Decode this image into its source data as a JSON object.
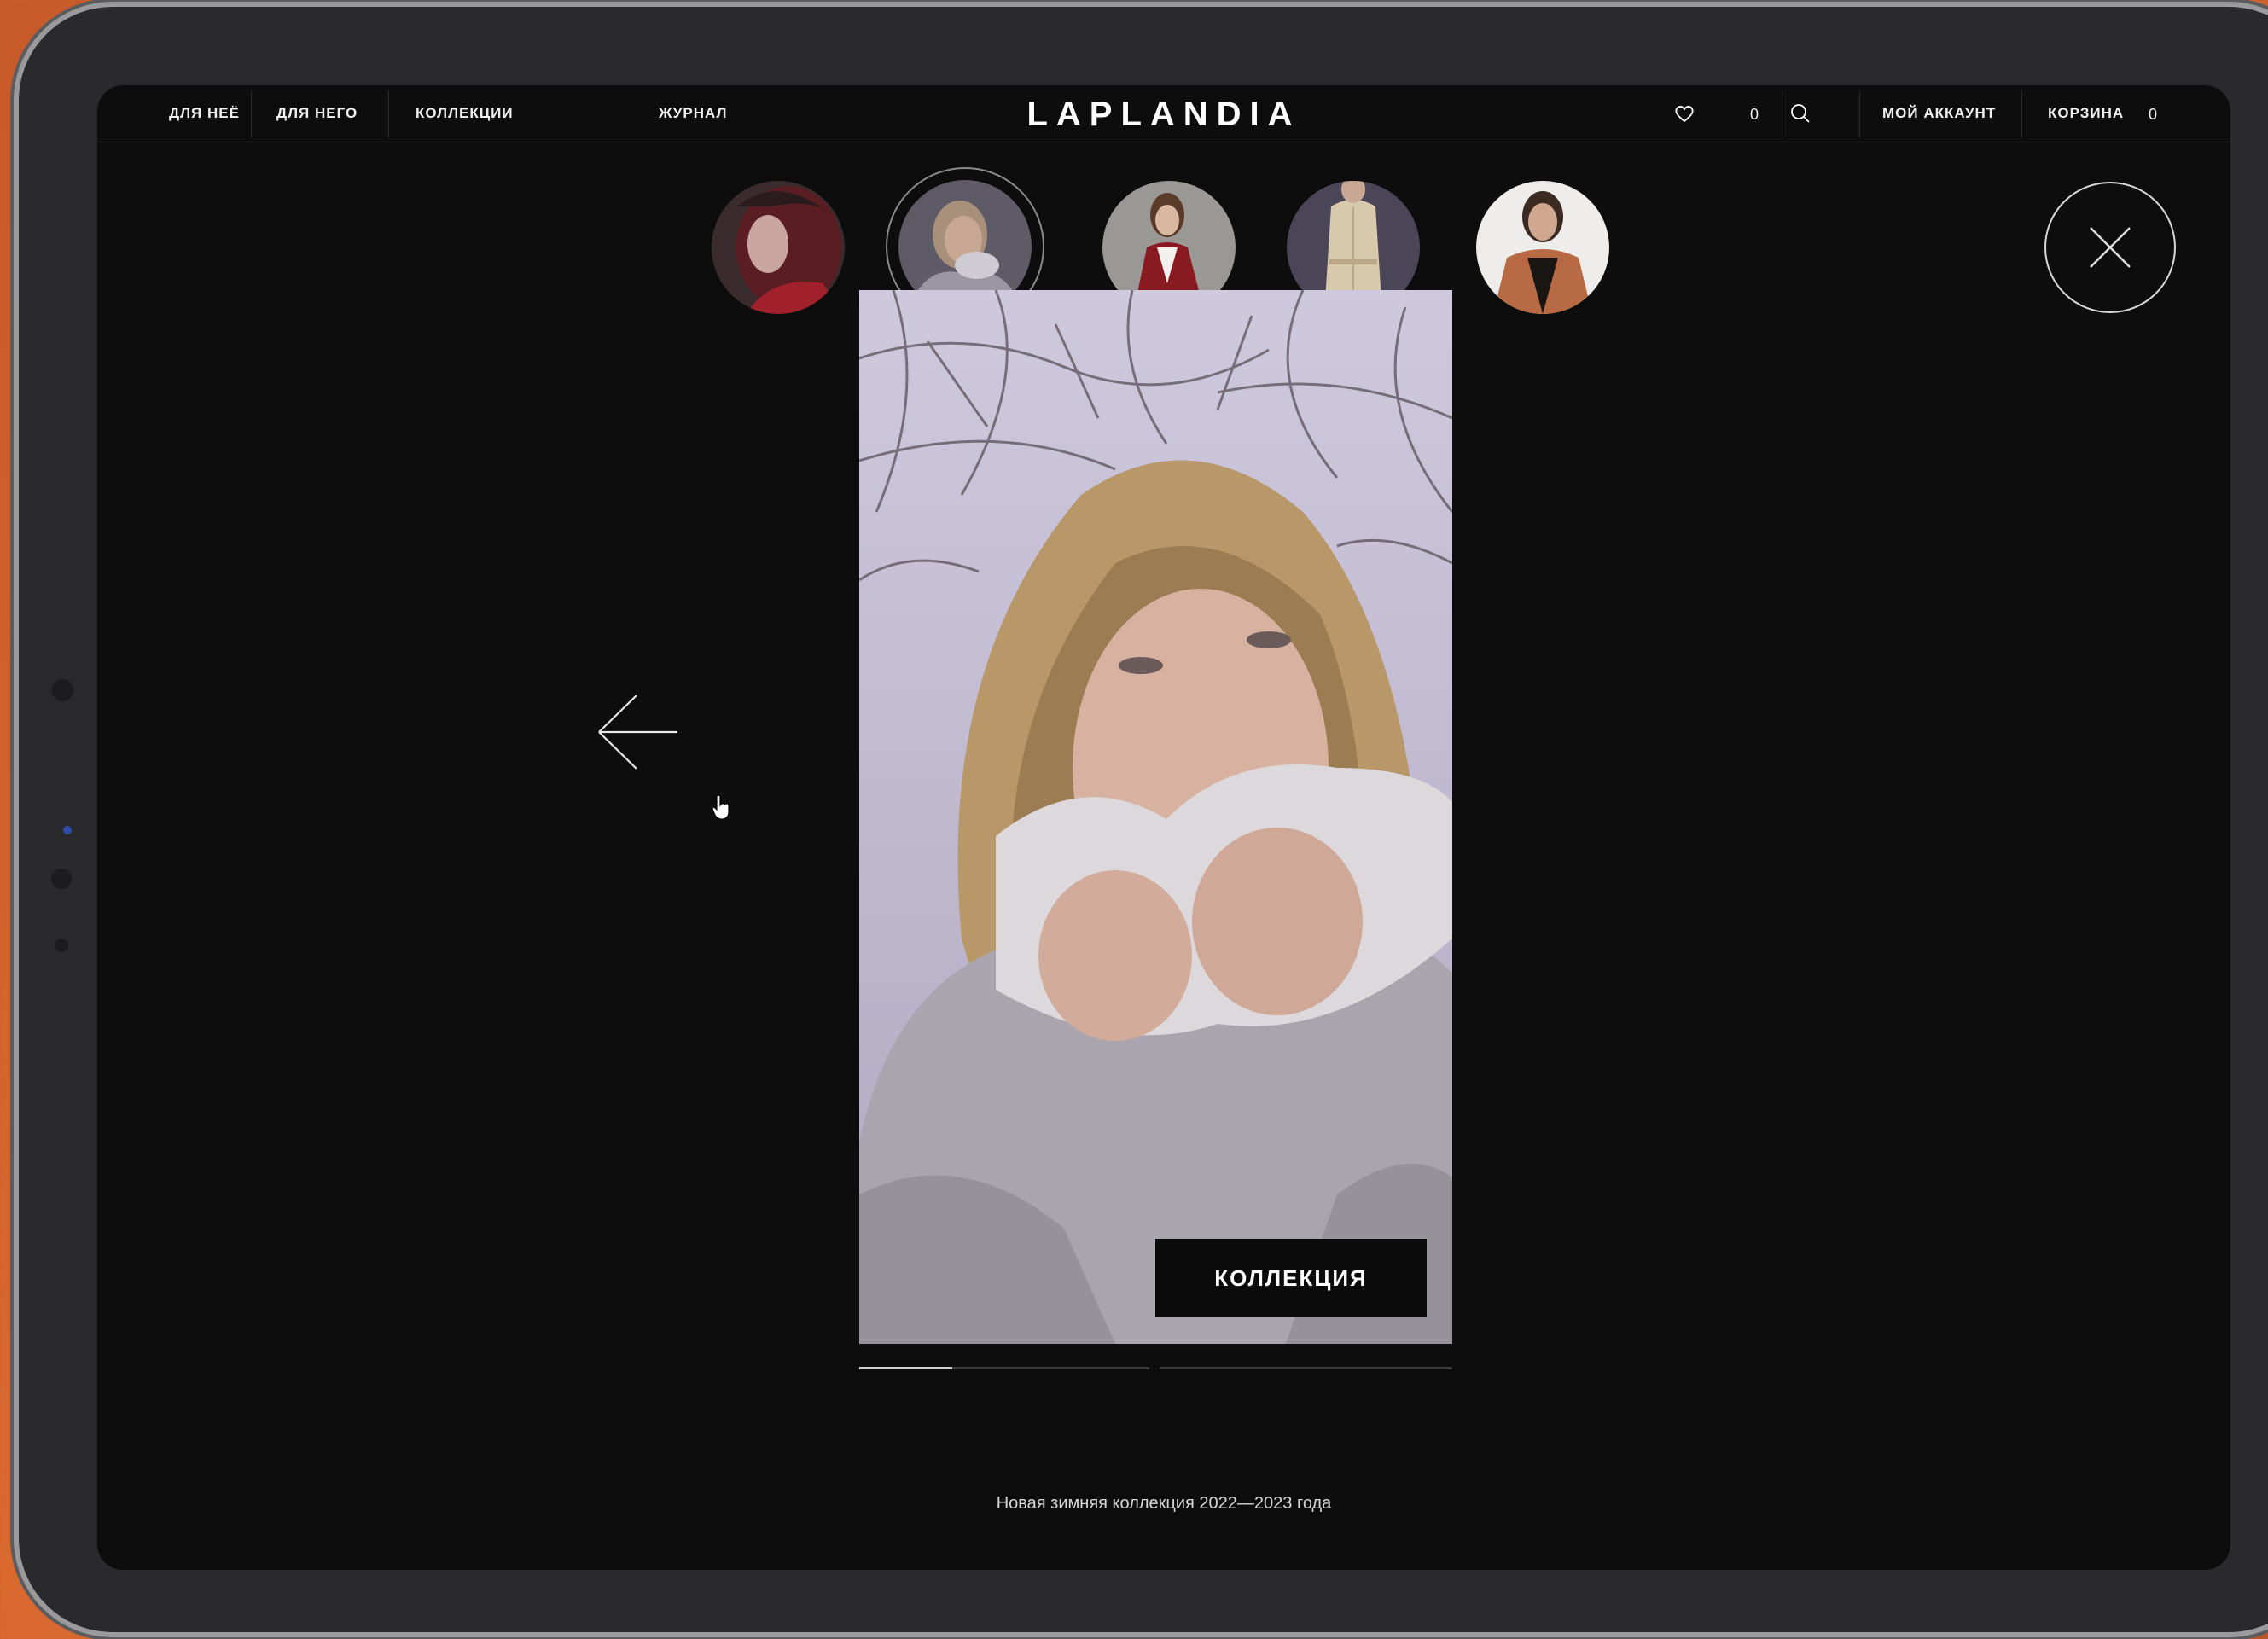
{
  "header": {
    "nav": [
      "ДЛЯ НЕЁ",
      "ДЛЯ НЕГО",
      "КОЛЛЕКЦИИ",
      "ЖУРНАЛ"
    ],
    "logo": "LAPLANDIA",
    "favorites_count": "0",
    "account_label": "МОЙ АККАУНТ",
    "cart_label": "КОРЗИНА",
    "cart_count": "0"
  },
  "stories": {
    "thumbnails": 5,
    "active_index": 1,
    "progress": [
      0.32,
      0
    ]
  },
  "story": {
    "button_label": "КОЛЛЕКЦИЯ",
    "caption": "Новая зимняя коллекция 2022—2023 года"
  },
  "colors": {
    "background": "#0d0d0e",
    "text": "#ffffff",
    "button_bg": "#0b0b0c",
    "frame": "#f07838"
  }
}
